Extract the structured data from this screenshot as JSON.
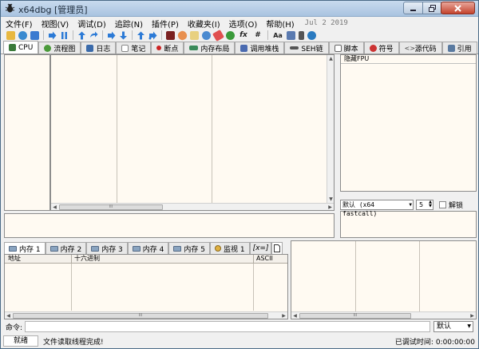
{
  "window": {
    "title": "x64dbg [管理员]"
  },
  "menu": {
    "items": [
      "文件(F)",
      "视图(V)",
      "调试(D)",
      "追踪(N)",
      "插件(P)",
      "收藏夹(I)",
      "选项(O)",
      "帮助(H)"
    ],
    "date": "Jul 2 2019"
  },
  "toolbar": {
    "icons": [
      "open-icon",
      "restart-icon",
      "stop-icon",
      "run-icon",
      "pause-icon",
      "step-into-icon",
      "step-over-icon",
      "run-to-user-icon",
      "step-out-icon",
      "trace-into-icon",
      "trace-over-icon",
      "execute-till-return-icon",
      "animate-icon",
      "patch-icon",
      "comment-icon",
      "label-icon",
      "bookmark-icon",
      "function-icon",
      "fx-icon",
      "hash-icon",
      "font-icon",
      "calculator-icon",
      "memory-icon",
      "globe-icon"
    ],
    "fx_label": "fx",
    "hash_label": "#",
    "font_label": "Aa"
  },
  "tabs": [
    {
      "name": "tab-cpu",
      "label": "CPU",
      "icon": "cpu-icon",
      "color": "#3a7a3a",
      "active": true
    },
    {
      "name": "tab-graph",
      "label": "流程图",
      "icon": "graph-icon",
      "color": "#4a9a3a"
    },
    {
      "name": "tab-log",
      "label": "日志",
      "icon": "log-icon",
      "color": "#3a6aaa"
    },
    {
      "name": "tab-notes",
      "label": "笔记",
      "icon": "notes-icon",
      "color": "#888888"
    },
    {
      "name": "tab-breakpoints",
      "label": "断点",
      "icon": "breakpoint-icon",
      "color": "#cc2222"
    },
    {
      "name": "tab-memory-map",
      "label": "内存布局",
      "icon": "memory-map-icon",
      "color": "#3a8a5a"
    },
    {
      "name": "tab-call-stack",
      "label": "调用堆栈",
      "icon": "call-stack-icon",
      "color": "#4a6ab0"
    },
    {
      "name": "tab-seh",
      "label": "SEH链",
      "icon": "seh-icon",
      "color": "#555555"
    },
    {
      "name": "tab-script",
      "label": "脚本",
      "icon": "script-icon",
      "color": "#666666"
    },
    {
      "name": "tab-symbols",
      "label": "符号",
      "icon": "symbols-icon",
      "color": "#cc3333"
    },
    {
      "name": "tab-source",
      "label": "源代码",
      "icon": "source-icon",
      "color": "#444444"
    },
    {
      "name": "tab-references",
      "label": "引用",
      "icon": "references-icon",
      "color": "#5a7aa0"
    }
  ],
  "registers": {
    "header": "隐藏FPU"
  },
  "callconv": {
    "value": "默认 (x64 fastcall)",
    "count": "5",
    "unlock_label": "解锁"
  },
  "memory_tabs": [
    {
      "label": "内存 1",
      "active": true
    },
    {
      "label": "内存 2"
    },
    {
      "label": "内存 3"
    },
    {
      "label": "内存 4"
    },
    {
      "label": "内存 5"
    },
    {
      "label": "监视 1",
      "icon": "watch-icon"
    },
    {
      "label": "[x=]",
      "icon": "locals-icon"
    }
  ],
  "dump": {
    "columns": [
      "地址",
      "十六进制",
      "ASCII"
    ]
  },
  "command": {
    "label": "命令:",
    "mode": "默认"
  },
  "status": {
    "state": "就绪",
    "message": "文件读取线程完成!",
    "time": "已调试时间: 0:00:00:00"
  },
  "scroll_grip": "lll"
}
